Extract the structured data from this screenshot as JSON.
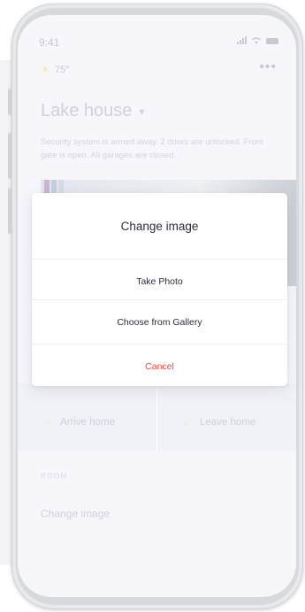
{
  "status_bar": {
    "time": "9:41"
  },
  "weather": {
    "temperature": "75°"
  },
  "home": {
    "title": "Lake house",
    "summary": "Security system is armed away. 2 doors are unlocked. Front gate is open. All garages are closed."
  },
  "actions": [
    {
      "label": "Arrive home"
    },
    {
      "label": "Leave home"
    }
  ],
  "room": {
    "section_label": "ROOM",
    "change_image_label": "Change image"
  },
  "modal": {
    "title": "Change image",
    "options": [
      {
        "label": "Take Photo"
      },
      {
        "label": "Choose from Gallery"
      }
    ],
    "cancel_label": "Cancel"
  },
  "colors": {
    "cancel": "#e9473f",
    "text_primary": "#2d2e3d",
    "screen_bg": "#f6f6fb"
  }
}
